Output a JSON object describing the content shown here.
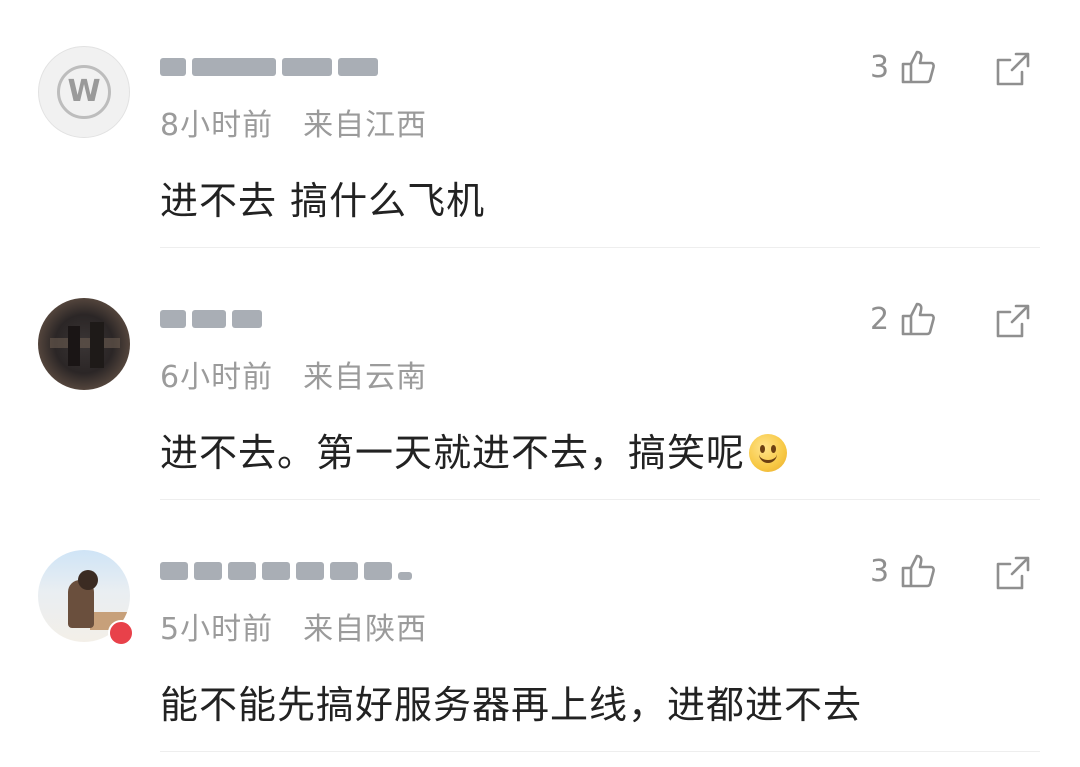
{
  "comments": [
    {
      "time": "8小时前",
      "location": "来自江西",
      "text": "进不去 搞什么飞机",
      "likes": "3",
      "avatar_icon": "w-logo",
      "icons": {
        "like": "thumb-up-icon",
        "share": "share-icon"
      }
    },
    {
      "time": "6小时前",
      "location": "来自云南",
      "text": "进不去。第一天就进不去，搞笑呢",
      "likes": "2",
      "emoji": "smile-emoji",
      "icons": {
        "like": "thumb-up-icon",
        "share": "share-icon"
      }
    },
    {
      "time": "5小时前",
      "location": "来自陕西",
      "text": "能不能先搞好服务器再上线，进都进不去",
      "likes": "3",
      "icons": {
        "like": "thumb-up-icon",
        "share": "share-icon"
      }
    }
  ],
  "colors": {
    "meta": "#9b9b9b",
    "text": "#222222",
    "icon": "#8f8f8f",
    "badge": "#e8414a"
  }
}
